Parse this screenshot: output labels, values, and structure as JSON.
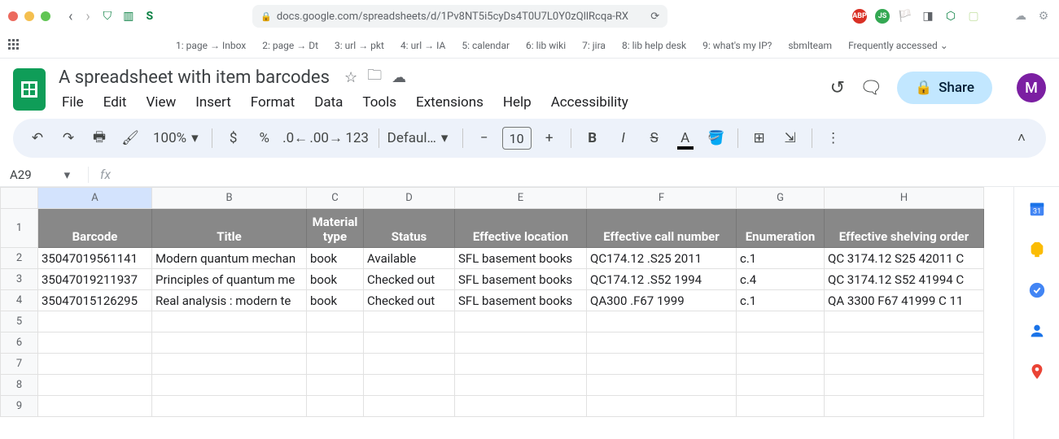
{
  "browser": {
    "url_display": "docs.google.com/spreadsheets/d/1Pv8NT5i5cyDs4T0U7L0Y0zQllRcqa-RX",
    "bookmarks": [
      "1: page → Inbox",
      "2: page → Dt",
      "3: url → pkt",
      "4: url → IA",
      "5: calendar",
      "6: lib wiki",
      "7: jira",
      "8: lib help desk",
      "9: what's my IP?",
      "sbmlteam",
      "Frequently accessed ⌄"
    ]
  },
  "doc": {
    "title": "A spreadsheet with item barcodes",
    "menus": [
      "File",
      "Edit",
      "View",
      "Insert",
      "Format",
      "Data",
      "Tools",
      "Extensions",
      "Help",
      "Accessibility"
    ],
    "share_label": "Share",
    "avatar_letter": "M"
  },
  "toolbar": {
    "zoom": "100%",
    "font": "Defaul…",
    "font_size": "10"
  },
  "name_box": "A29",
  "columns": [
    "A",
    "B",
    "C",
    "D",
    "E",
    "F",
    "G",
    "H"
  ],
  "headers": [
    "Barcode",
    "Title",
    "Material type",
    "Status",
    "Effective location",
    "Effective call number",
    "Enumeration",
    "Effective shelving order"
  ],
  "rows": [
    [
      "35047019561141",
      "Modern quantum mechan",
      "book",
      "Available",
      "SFL basement books",
      "QC174.12 .S25 2011",
      "c.1",
      "QC 3174.12 S25 42011 C"
    ],
    [
      "35047019211937",
      "Principles of quantum me",
      "book",
      "Checked out",
      "SFL basement books",
      "QC174.12 .S52 1994",
      "c.4",
      "QC 3174.12 S52 41994 C"
    ],
    [
      "35047015126295",
      "Real analysis : modern te",
      "book",
      "Checked out",
      "SFL basement books",
      "QA300 .F67 1999",
      "c.1",
      "QA 3300 F67 41999 C 11"
    ]
  ],
  "empty_rows": [
    5,
    6,
    7,
    8,
    9
  ]
}
